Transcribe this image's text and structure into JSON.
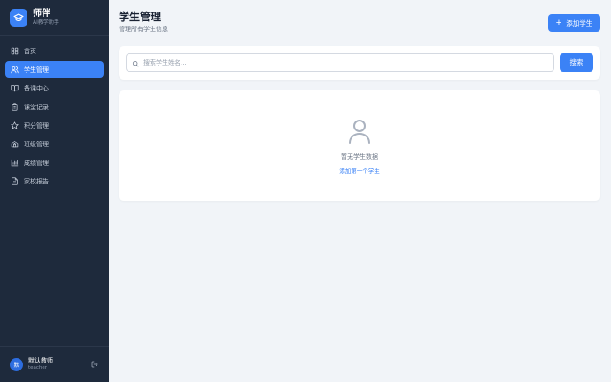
{
  "brand": {
    "name": "师伴",
    "subtitle": "AI教学助手"
  },
  "nav": [
    {
      "label": "首页",
      "icon": "grid-icon",
      "active": false
    },
    {
      "label": "学生管理",
      "icon": "users-icon",
      "active": true
    },
    {
      "label": "备课中心",
      "icon": "book-open-icon",
      "active": false
    },
    {
      "label": "课堂记录",
      "icon": "clipboard-icon",
      "active": false
    },
    {
      "label": "积分管理",
      "icon": "star-icon",
      "active": false
    },
    {
      "label": "班级管理",
      "icon": "school-icon",
      "active": false
    },
    {
      "label": "成绩管理",
      "icon": "bar-chart-icon",
      "active": false
    },
    {
      "label": "家校报告",
      "icon": "file-text-icon",
      "active": false
    }
  ],
  "user": {
    "avatar": "默",
    "name": "默认教师",
    "role": "teacher"
  },
  "header": {
    "title": "学生管理",
    "subtitle": "管理所有学生信息",
    "add_label": "添加学生"
  },
  "search": {
    "placeholder": "搜索学生姓名...",
    "button_label": "搜索"
  },
  "empty": {
    "message": "暂无学生数据",
    "link_label": "添加第一个学生"
  },
  "colors": {
    "accent": "#3b82f6",
    "sidebar": "#1e2a3c",
    "background": "#f1f4f8"
  }
}
